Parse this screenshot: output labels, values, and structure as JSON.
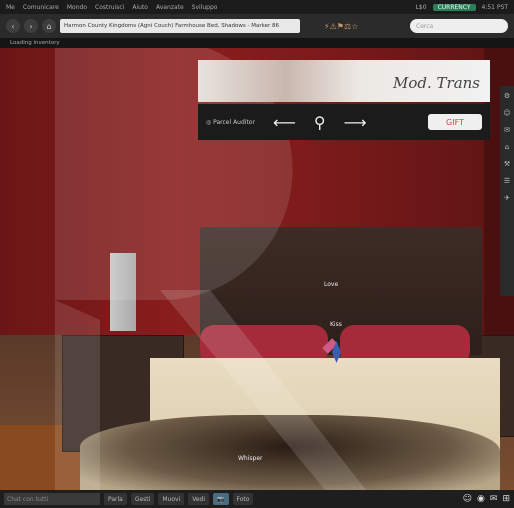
{
  "menubar": {
    "items": [
      "Me",
      "Comunicare",
      "Mondo",
      "Costruisci",
      "Aiuto",
      "Avanzate",
      "Sviluppo"
    ],
    "status_time": "4:51 PST",
    "pill": "CURRENCY",
    "balance": "L$0"
  },
  "navbar": {
    "back": "‹",
    "forward": "›",
    "home": "⌂",
    "address": "Harmon County Kingdoms (Agni Couch) Farmhouse Bed, Shadows - Marker 86",
    "icons": "⚡⚠⚑⚖☆",
    "search_placeholder": "Cerca"
  },
  "statusline": {
    "text": "Loading inventory"
  },
  "hud": {
    "title": "Mod. Trans",
    "logo": "◎ Parcel Auditor",
    "prev": "⟵",
    "zoom": "⚲",
    "next": "⟶",
    "gift": "GIFT"
  },
  "scene": {
    "label_top": "Love",
    "label_mid": "Kiss",
    "label_bottom": "Whisper"
  },
  "rightbar": {
    "icons": [
      "⚙",
      "☺",
      "✉",
      "⌂",
      "⚒",
      "☰",
      "✈"
    ]
  },
  "bottombar": {
    "chat_placeholder": "Chat con tutti",
    "speak": "Parla",
    "gestures": "Gesti",
    "move": "Muovi",
    "view": "Vedi",
    "camera": "📷",
    "snapshot": "Foto",
    "icons_right": [
      "☺",
      "◉",
      "✉",
      "⊞"
    ]
  }
}
